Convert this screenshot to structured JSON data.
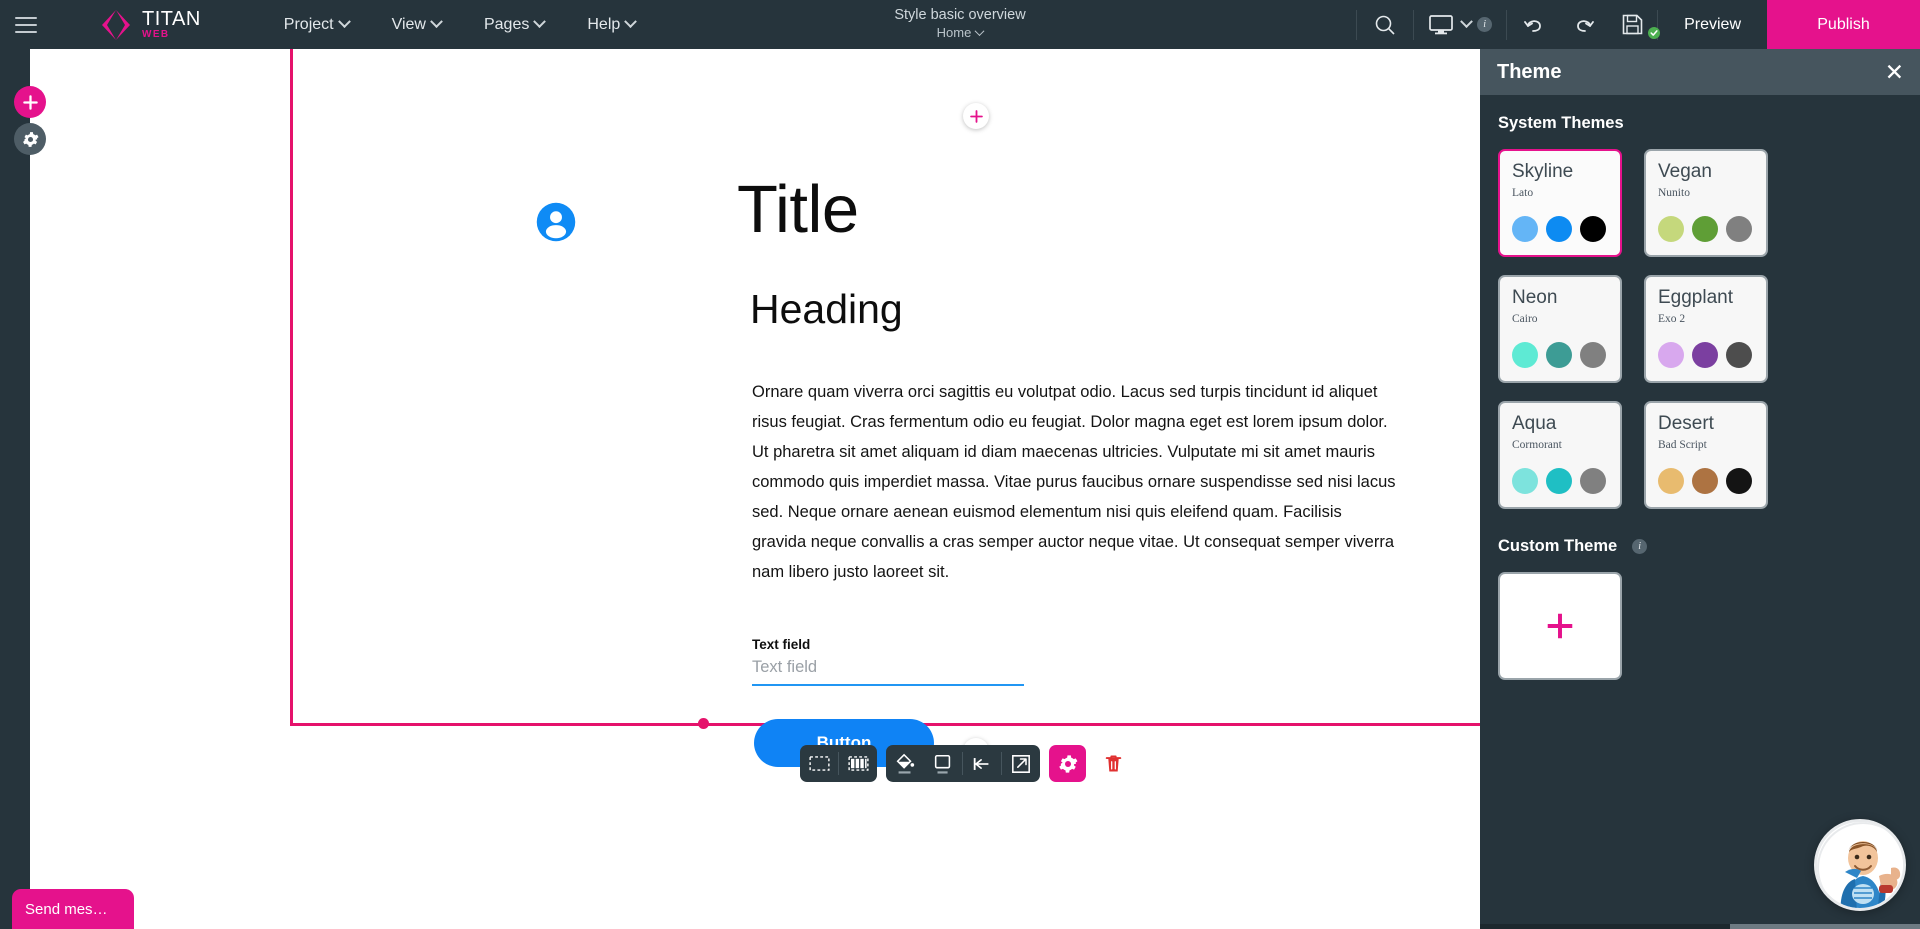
{
  "topbar": {
    "brand_title": "TITAN",
    "brand_sub": "WEB",
    "menus": [
      {
        "label": "Project"
      },
      {
        "label": "View"
      },
      {
        "label": "Pages"
      },
      {
        "label": "Help"
      }
    ],
    "doc_title": "Style basic overview",
    "doc_page": "Home",
    "search_icon": "search-icon",
    "device_icon": "desktop-monitor-icon",
    "info_icon": "i",
    "undo_icon": "undo-arrow-icon",
    "redo_icon": "redo-arrow-icon",
    "save_icon": "floppy-disk-save-icon",
    "preview_label": "Preview",
    "publish_label": "Publish",
    "accent_color": "#e5128c",
    "bar_color": "#26343c"
  },
  "left_rail": {
    "add_icon": "plus-icon",
    "settings_icon": "gear-icon"
  },
  "canvas": {
    "add_section_icon": "plus-icon",
    "person_icon": "user-avatar-icon",
    "person_color": "#0f83f5",
    "title": "Title",
    "heading": "Heading",
    "paragraph": "Ornare quam viverra orci sagittis eu volutpat odio. Lacus sed turpis tincidunt id aliquet risus feugiat. Cras fermentum odio eu feugiat. Dolor magna eget est lorem ipsum dolor. Ut pharetra sit amet aliquam id diam maecenas ultricies. Vulputate mi sit amet mauris commodo quis imperdiet massa. Vitae purus faucibus ornare suspendisse sed nisi lacus sed. Neque ornare aenean euismod elementum nisi quis eleifend quam. Facilisis gravida neque convallis a cras semper auctor neque vitae. Ut consequat semper viverra nam libero justo laoreet sit.",
    "field_label": "Text field",
    "field_value": "",
    "field_placeholder": "Text field",
    "button_label": "Button",
    "button_color": "#0f83f5",
    "selection_color": "#e5126b"
  },
  "float_toolbar": {
    "items": [
      {
        "name": "select-section-icon",
        "glyph": "dashed-rect"
      },
      {
        "name": "select-columns-icon",
        "glyph": "dashed-columns"
      },
      {
        "name": "fill-background-icon",
        "glyph": "paint-bucket"
      },
      {
        "name": "border-style-icon",
        "glyph": "square-outline"
      },
      {
        "name": "align-left-icon",
        "glyph": "align-left"
      },
      {
        "name": "open-external-icon",
        "glyph": "external-link"
      },
      {
        "name": "settings-icon",
        "glyph": "gear"
      },
      {
        "name": "delete-icon",
        "glyph": "trash"
      }
    ],
    "gear_bg": "#e5128c",
    "trash_color": "#e03131"
  },
  "panel": {
    "title": "Theme",
    "close_icon": "close-icon",
    "system_themes_label": "System Themes",
    "custom_theme_label": "Custom Theme",
    "custom_info_icon": "i",
    "custom_add_icon": "plus-icon",
    "themes": [
      {
        "name": "Skyline",
        "font": "Lato",
        "selected": true,
        "colors": [
          "#64b5f6",
          "#0d8bf2",
          "#000000"
        ]
      },
      {
        "name": "Vegan",
        "font": "Nunito",
        "selected": false,
        "colors": [
          "#c5d87c",
          "#5f9e36",
          "#808080"
        ]
      },
      {
        "name": "Neon",
        "font": "Cairo",
        "selected": false,
        "colors": [
          "#5eead4",
          "#3d9c95",
          "#808080"
        ]
      },
      {
        "name": "Eggplant",
        "font": "Exo 2",
        "selected": false,
        "colors": [
          "#d8a8ee",
          "#7b3fa0",
          "#4d4d4d"
        ]
      },
      {
        "name": "Aqua",
        "font": "Cormorant",
        "selected": false,
        "colors": [
          "#7de3dd",
          "#1fbfc4",
          "#808080"
        ]
      },
      {
        "name": "Desert",
        "font": "Bad Script",
        "selected": false,
        "colors": [
          "#e8bb6f",
          "#ad7342",
          "#141414"
        ]
      }
    ]
  },
  "chat": {
    "message_label": "Send mes…",
    "avatar_icon": "support-mascot-avatar"
  }
}
